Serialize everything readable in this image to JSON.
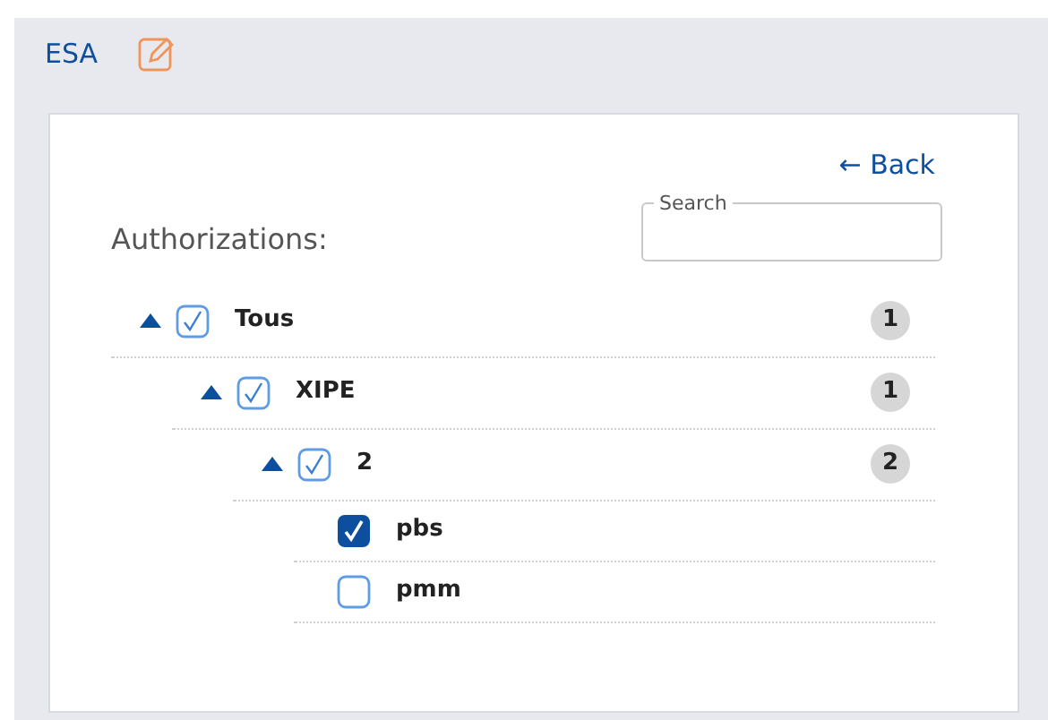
{
  "header": {
    "title": "ESA"
  },
  "back_link": {
    "label": "← Back"
  },
  "section_label": "Authorizations:",
  "search": {
    "label": "Search"
  },
  "tree": [
    {
      "label": "Tous",
      "indeterminate": true,
      "expanded": true,
      "count": "1",
      "children": [
        {
          "label": "XIPE",
          "indeterminate": true,
          "expanded": true,
          "count": "1",
          "children": [
            {
              "label": "2",
              "indeterminate": true,
              "expanded": true,
              "count": "2",
              "children": [
                {
                  "label": "pbs",
                  "checked": true
                },
                {
                  "label": "pmm",
                  "checked": false
                }
              ]
            }
          ]
        }
      ]
    }
  ]
}
